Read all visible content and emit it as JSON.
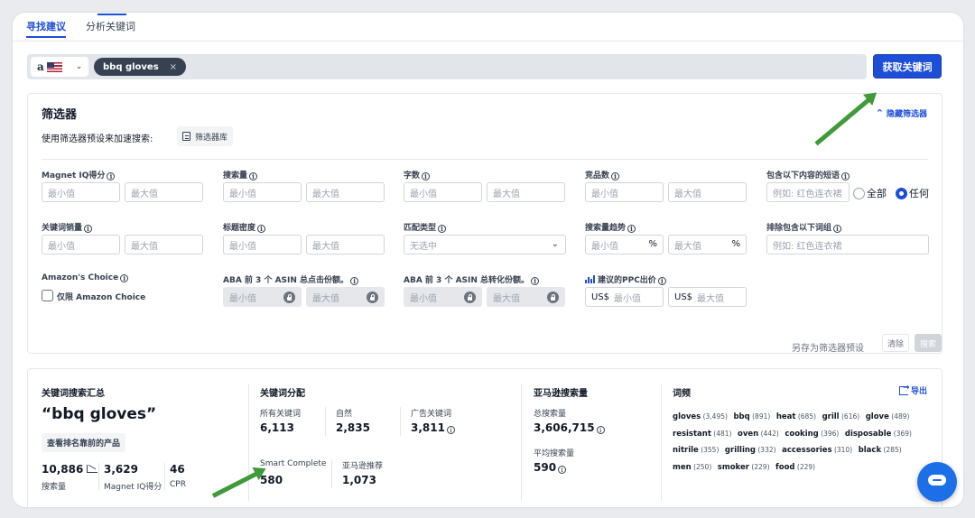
{
  "tabs": [
    {
      "label": "寻找建议",
      "active": true
    },
    {
      "label": "分析关键词",
      "active": false
    }
  ],
  "search": {
    "marketplace": "a",
    "keyword_chip": "bbq gloves",
    "chip_remove": "×",
    "submit_label": "获取关键词"
  },
  "filters": {
    "title": "筛选器",
    "hide_label": "隐藏筛选器",
    "preset_prompt": "使用筛选器预设来加速搜索:",
    "preset_library_label": "筛选器库",
    "row1": {
      "magnet_iq_score": {
        "label": "Magnet IQ得分",
        "min": "最小值",
        "max": "最大值"
      },
      "search_volume": {
        "label": "搜索量",
        "min": "最小值",
        "max": "最大值"
      },
      "word_count": {
        "label": "字数",
        "min": "最小值",
        "max": "最大值"
      },
      "competing_products": {
        "label": "竞品数",
        "min": "最小值",
        "max": "最大值"
      },
      "include_phrases": {
        "label": "包含以下内容的短语",
        "placeholder": "例如: 红色连衣裙",
        "option_all": "全部",
        "option_any": "任何",
        "selected": "任何"
      }
    },
    "row2": {
      "keyword_sales": {
        "label": "关键词销量",
        "min": "最小值",
        "max": "最大值"
      },
      "title_density": {
        "label": "标题密度",
        "min": "最小值",
        "max": "最大值"
      },
      "match_type": {
        "label": "匹配类型",
        "value": "无选中"
      },
      "search_trend": {
        "label": "搜索量趋势",
        "min": "最小值",
        "max": "最大值",
        "unit": "%"
      },
      "exclude_words": {
        "label": "排除包含以下词组",
        "placeholder": "例如: 红色连衣裙"
      }
    },
    "row3": {
      "amazons_choice": {
        "label": "Amazon's Choice",
        "checkbox_label": "仅限 Amazon Choice",
        "checked": false
      },
      "aba_click_share": {
        "label": "ABA 前 3 个 ASIN 总点击份额。",
        "min": "最小值",
        "max": "最大值"
      },
      "aba_conversion_share": {
        "label": "ABA 前 3 个 ASIN 总转化份额。",
        "min": "最小值",
        "max": "最大值"
      },
      "suggested_ppc": {
        "label": "建议的PPC出价",
        "currency": "US$",
        "min": "最小值",
        "max": "最大值"
      }
    },
    "actions": {
      "save_preset": "另存为筛选器预设",
      "clear": "清除",
      "search": "搜索"
    }
  },
  "summary": {
    "overview": {
      "title": "关键词搜索汇总",
      "keyword": "“bbq gloves”",
      "view_products": "查看排名靠前的产品",
      "search_volume": {
        "value": "10,886",
        "label": "搜索量"
      },
      "magnet_iq": {
        "value": "3,629",
        "label": "Magnet IQ得分"
      },
      "cpr": {
        "value": "46",
        "label": "CPR"
      }
    },
    "distribution": {
      "title": "关键词分配",
      "all_keywords": {
        "label": "所有关键词",
        "value": "6,113"
      },
      "organic": {
        "label": "自然",
        "value": "2,835"
      },
      "sponsored": {
        "label": "广告关键词",
        "value": "3,811"
      },
      "smart_complete": {
        "label": "Smart Complete",
        "value": "580"
      },
      "amazon_recommended": {
        "label": "亚马逊推荐",
        "value": "1,073"
      }
    },
    "amazon_search": {
      "title": "亚马逊搜索量",
      "total": {
        "label": "总搜索量",
        "value": "3,606,715"
      },
      "average": {
        "label": "平均搜索量",
        "value": "590"
      }
    },
    "word_frequency": {
      "title": "词频",
      "export_label": "导出",
      "terms": [
        {
          "word": "gloves",
          "count": "(3,495)"
        },
        {
          "word": "bbq",
          "count": "(891)"
        },
        {
          "word": "heat",
          "count": "(685)"
        },
        {
          "word": "grill",
          "count": "(616)"
        },
        {
          "word": "glove",
          "count": "(489)"
        },
        {
          "word": "resistant",
          "count": "(481)"
        },
        {
          "word": "oven",
          "count": "(442)"
        },
        {
          "word": "cooking",
          "count": "(396)"
        },
        {
          "word": "disposable",
          "count": "(369)"
        },
        {
          "word": "nitrile",
          "count": "(355)"
        },
        {
          "word": "grilling",
          "count": "(332)"
        },
        {
          "word": "accessories",
          "count": "(310)"
        },
        {
          "word": "black",
          "count": "(285)"
        },
        {
          "word": "men",
          "count": "(250)"
        },
        {
          "word": "smoker",
          "count": "(229)"
        },
        {
          "word": "food",
          "count": "(229)"
        }
      ]
    }
  },
  "colors": {
    "accent": "#1d4ed8",
    "arrow": "#3f9a3a"
  },
  "icons": [
    "info-icon",
    "chevron-down-icon",
    "chevron-up-icon",
    "lock-icon",
    "export-icon",
    "trend-chart-icon",
    "bar-chart-icon",
    "document-icon",
    "chat-icon",
    "close-icon"
  ]
}
